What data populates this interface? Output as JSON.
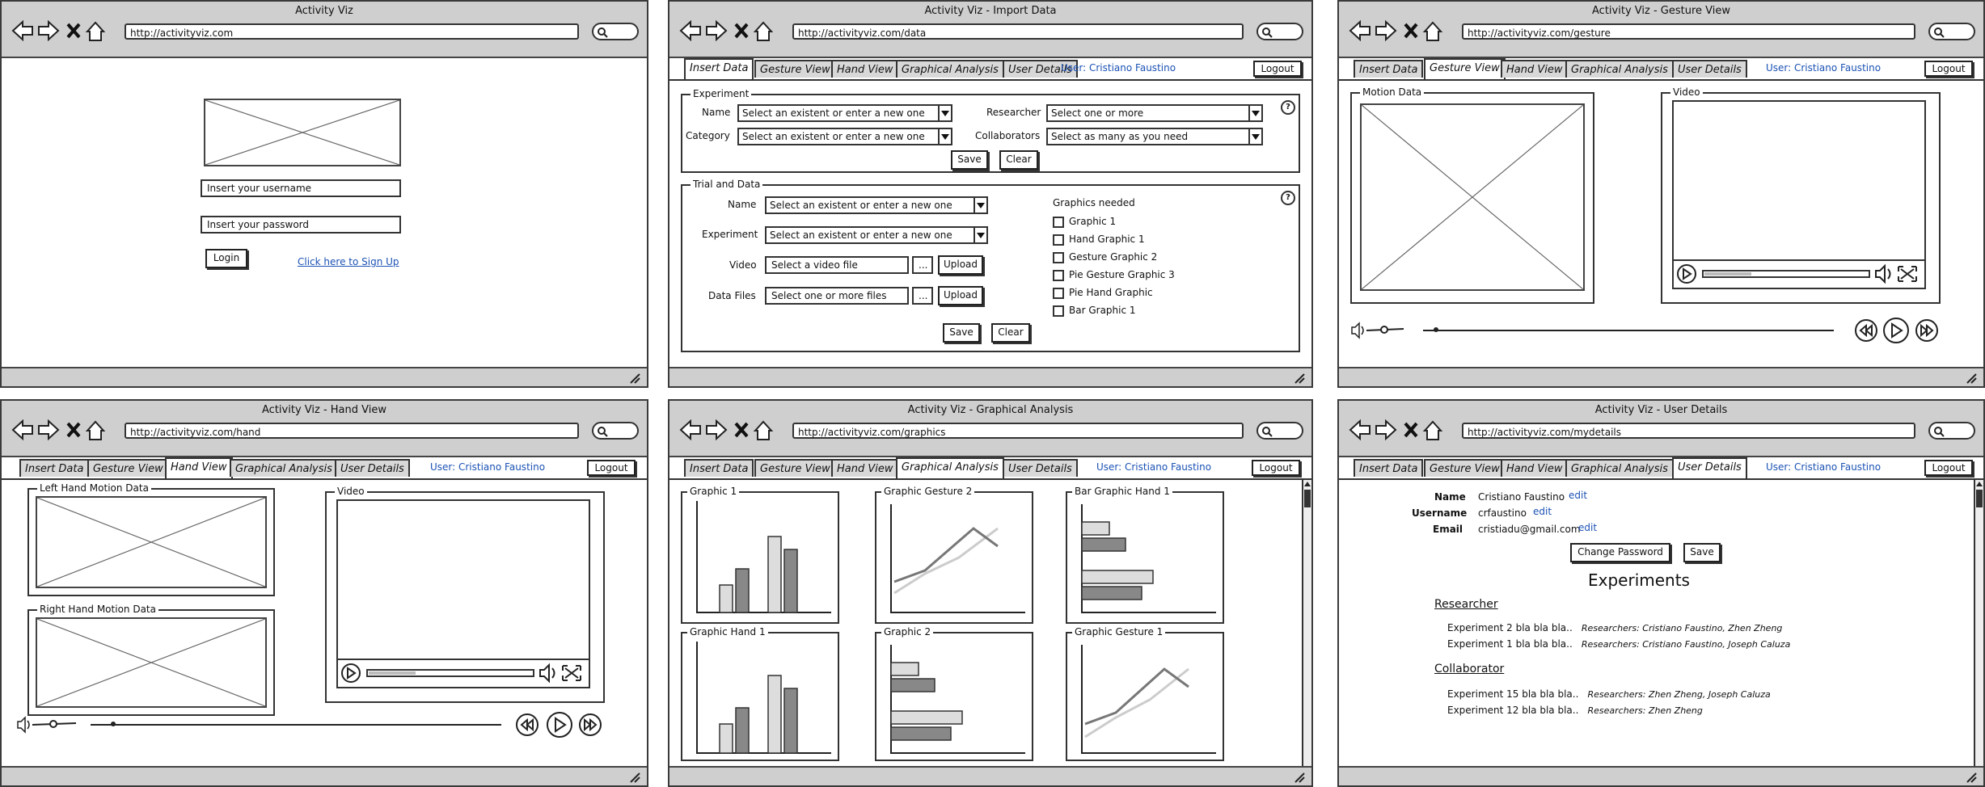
{
  "windows": {
    "login": {
      "title": "Activity Viz",
      "url": "http://activityviz.com",
      "username_placeholder": "Insert your username",
      "password_placeholder": "Insert your password",
      "login_label": "Login",
      "signup_link": "Click here to Sign Up"
    },
    "import": {
      "title": "Activity Viz - Import Data",
      "url": "http://activityviz.com/data"
    },
    "gesture": {
      "title": "Activity Viz - Gesture View",
      "url": "http://activityviz.com/gesture",
      "motion_legend": "Motion Data",
      "video_legend": "Video"
    },
    "hand": {
      "title": "Activity Viz - Hand View",
      "url": "http://activityviz.com/hand",
      "left_legend": "Left Hand Motion Data",
      "right_legend": "Right Hand Motion Data",
      "video_legend": "Video"
    },
    "graphs": {
      "title": "Activity Viz - Graphical Analysis",
      "url": "http://activityviz.com/graphics",
      "panels": [
        "Graphic 1",
        "Graphic Gesture 2",
        "Bar Graphic Hand 1",
        "Graphic Hand 1",
        "Graphic 2",
        "Graphic Gesture 1"
      ]
    },
    "details": {
      "title": "Activity Viz - User Details",
      "url": "http://activityviz.com/mydetails"
    }
  },
  "tabs": [
    "Insert Data",
    "Gesture View",
    "Hand View",
    "Graphical Analysis",
    "User Details"
  ],
  "user_label": "User: Cristiano Faustino",
  "logout_label": "Logout",
  "experiment_form": {
    "legend": "Experiment",
    "name_label": "Name",
    "name_value": "Select an existent or enter a new one",
    "category_label": "Category",
    "category_value": "Select an existent or enter a new one",
    "researcher_label": "Researcher",
    "researcher_value": "Select one or more",
    "collaborators_label": "Collaborators",
    "collaborators_value": "Select as many as you need",
    "save_label": "Save",
    "clear_label": "Clear"
  },
  "trial_form": {
    "legend": "Trial and Data",
    "name_label": "Name",
    "name_value": "Select an existent or enter a new one",
    "experiment_label": "Experiment",
    "experiment_value": "Select an existent or enter a new one",
    "video_label": "Video",
    "video_value": "Select a video file",
    "datafiles_label": "Data Files",
    "datafiles_value": "Select one or more files",
    "browse_label": "...",
    "upload_label": "Upload",
    "save_label": "Save",
    "clear_label": "Clear",
    "graphics_title": "Graphics needed",
    "graphics": [
      "Graphic 1",
      "Hand Graphic 1",
      "Gesture Graphic 2",
      "Pie Gesture Graphic 3",
      "Pie Hand Graphic",
      "Bar Graphic 1"
    ]
  },
  "user_details": {
    "name_label": "Name",
    "name_value": "Cristiano Faustino",
    "username_label": "Username",
    "username_value": "crfaustino",
    "email_label": "Email",
    "email_value": "cristiadu@gmail.com",
    "edit_label": "edit",
    "change_password_label": "Change Password",
    "save_label": "Save",
    "experiments_title": "Experiments",
    "researcher_title": "Researcher",
    "researcher_items": [
      {
        "name": "Experiment 2 bla bla bla..",
        "researchers": "Researchers: Cristiano Faustino, Zhen Zheng"
      },
      {
        "name": "Experiment 1 bla bla bla..",
        "researchers": "Researchers: Cristiano Faustino, Joseph Caluza"
      }
    ],
    "collaborator_title": "Collaborator",
    "collaborator_items": [
      {
        "name": "Experiment 15 bla bla bla..",
        "researchers": "Researchers: Zhen Zheng, Joseph Caluza"
      },
      {
        "name": "Experiment 12 bla bla bla..",
        "researchers": "Researchers: Zhen Zheng"
      }
    ]
  },
  "icons": [
    "back-icon",
    "forward-icon",
    "stop-icon",
    "home-icon",
    "search-icon",
    "resize-grip-icon",
    "play-icon",
    "rewind-icon",
    "fast-forward-icon",
    "volume-icon",
    "fullscreen-icon",
    "help-icon"
  ]
}
